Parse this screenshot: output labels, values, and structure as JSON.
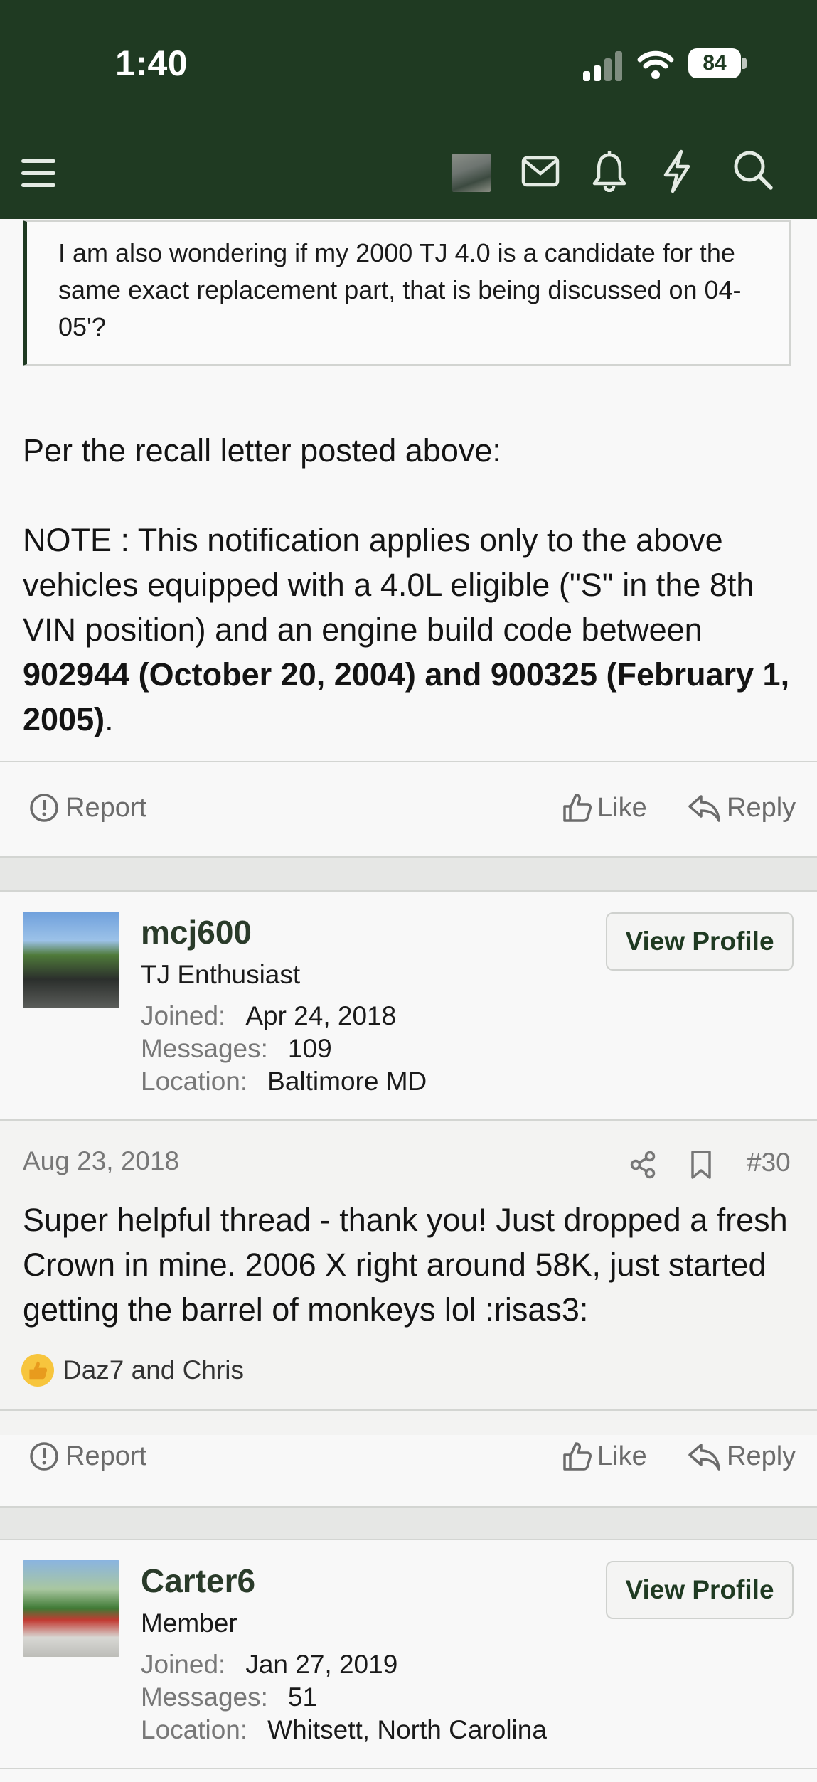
{
  "status_bar": {
    "time": "1:40",
    "battery": "84"
  },
  "nav": {
    "icons": [
      "menu-icon",
      "avatar",
      "mail-icon",
      "bell-icon",
      "bolt-icon",
      "search-icon"
    ]
  },
  "quote": {
    "text": "I am also wondering if my 2000 TJ 4.0 is a candidate for the same exact replacement part, that is being discussed on 04-05'?"
  },
  "post1": {
    "line1": "Per the recall letter posted above:",
    "note_plain": "NOTE : This notification applies only to the above vehicles equipped with a 4.0L eligible (\"S\" in the 8th VIN position) and an engine build code between ",
    "note_bold": "902944 (October 20, 2004) and 900325 (February 1, 2005)",
    "note_end": ".",
    "actions": {
      "report": "Report",
      "like": "Like",
      "reply": "Reply"
    }
  },
  "post2": {
    "user": {
      "name": "mcj600",
      "title": "TJ Enthusiast",
      "joined_label": "Joined:",
      "joined": "Apr 24, 2018",
      "messages_label": "Messages:",
      "messages": "109",
      "location_label": "Location:",
      "location": "Baltimore MD",
      "view_profile": "View Profile"
    },
    "date": "Aug 23, 2018",
    "number": "#30",
    "body": "Super helpful thread - thank you! Just dropped a fresh Crown in mine. 2006 X right around 58K, just started getting the barrel of monkeys lol :risas3:",
    "reactions": "Daz7 and Chris",
    "actions": {
      "report": "Report",
      "like": "Like",
      "reply": "Reply"
    }
  },
  "post3": {
    "user": {
      "name": "Carter6",
      "title": "Member",
      "joined_label": "Joined:",
      "joined": "Jan 27, 2019",
      "messages_label": "Messages:",
      "messages": "51",
      "location_label": "Location:",
      "location": "Whitsett, North Carolina",
      "view_profile": "View Profile"
    }
  },
  "colors": {
    "header": "#1f3a22",
    "accent": "#2a3b2a",
    "reaction": "#f7c53d"
  }
}
